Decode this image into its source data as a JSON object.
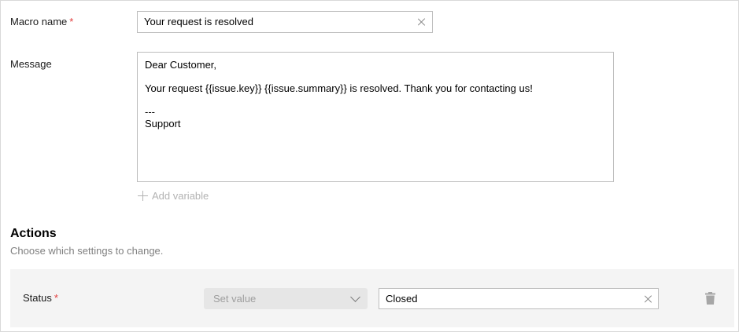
{
  "macro_name": {
    "label": "Macro name",
    "required_mark": "*",
    "value": "Your request is resolved"
  },
  "message": {
    "label": "Message",
    "lines": [
      "Dear Customer,",
      "Your request {{issue.key}} {{issue.summary}} is resolved. Thank you for contacting us!",
      "---",
      "Support"
    ],
    "add_variable_label": "Add variable"
  },
  "actions": {
    "title": "Actions",
    "subtitle": "Choose which settings to change.",
    "rows": [
      {
        "field_label": "Status",
        "required_mark": "*",
        "operation": "Set value",
        "value": "Closed"
      }
    ]
  },
  "icons": {
    "clear": "close-icon",
    "plus": "plus-icon",
    "chevron": "chevron-down-icon",
    "delete": "trash-icon"
  },
  "colors": {
    "required": "#e23c3c",
    "muted_text": "#808080",
    "disabled_text": "#b3b3b3",
    "row_background": "#f4f4f4",
    "select_background": "#e6e6e6"
  }
}
